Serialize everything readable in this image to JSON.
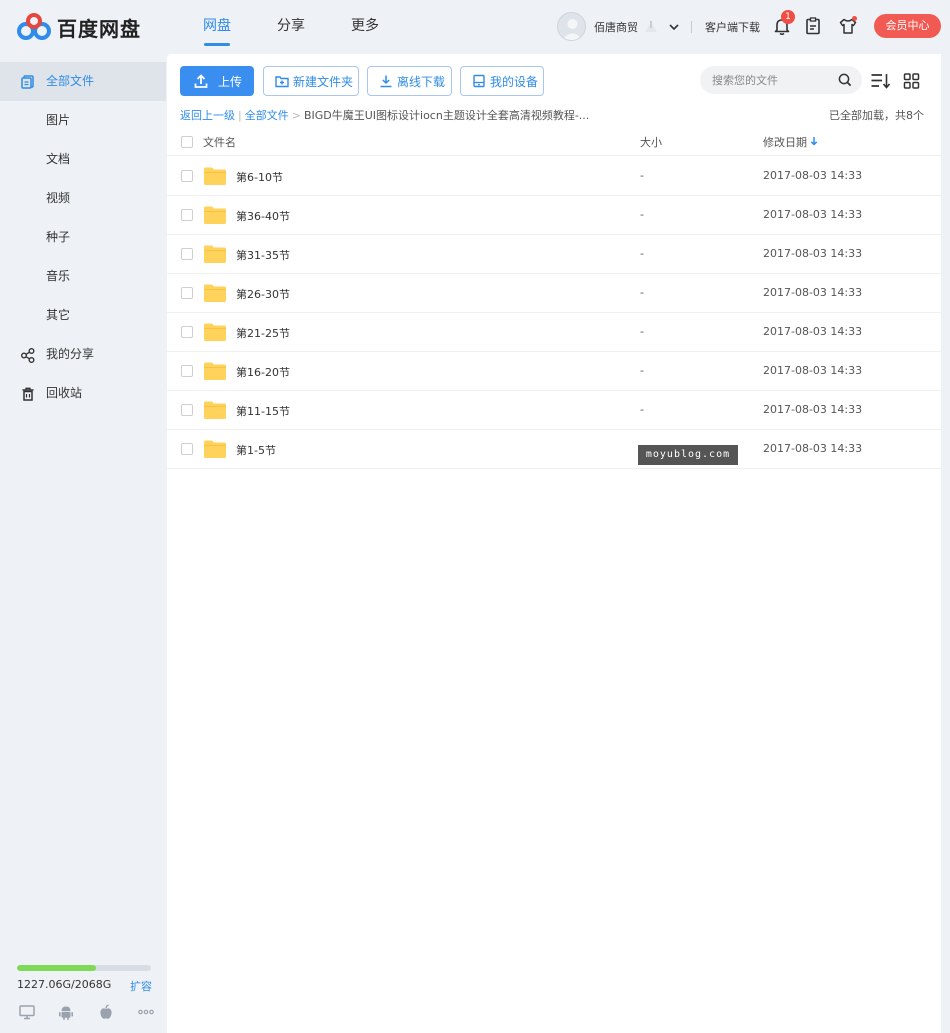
{
  "app": {
    "name": "百度网盘"
  },
  "nav": {
    "tabs": [
      {
        "label": "网盘",
        "active": true
      },
      {
        "label": "分享",
        "active": false
      },
      {
        "label": "更多",
        "active": false
      }
    ]
  },
  "user": {
    "name": "佰唐商贸"
  },
  "header": {
    "client_download": "客户端下载",
    "notification_count": "1",
    "vip_label": "会员中心"
  },
  "colors": {
    "accent": "#2f8ce8",
    "vip": "#f15a52",
    "folder": "#ffd25c",
    "storage": "#7ed957"
  },
  "sidebar": {
    "items": [
      {
        "label": "全部文件",
        "icon": "all-files-icon",
        "active": true
      },
      {
        "label": "图片",
        "icon": "",
        "active": false
      },
      {
        "label": "文档",
        "icon": "",
        "active": false
      },
      {
        "label": "视频",
        "icon": "",
        "active": false
      },
      {
        "label": "种子",
        "icon": "",
        "active": false
      },
      {
        "label": "音乐",
        "icon": "",
        "active": false
      },
      {
        "label": "其它",
        "icon": "",
        "active": false
      },
      {
        "label": "我的分享",
        "icon": "share-icon",
        "active": false
      },
      {
        "label": "回收站",
        "icon": "trash-icon",
        "active": false
      }
    ],
    "storage": {
      "text": "1227.06G/2068G",
      "used_fraction": 0.593,
      "expand_label": "扩容"
    },
    "platforms": [
      "desktop-icon",
      "android-icon",
      "apple-icon",
      "more-icon"
    ]
  },
  "toolbar": {
    "upload_label": "上传",
    "new_folder_label": "新建文件夹",
    "offline_download_label": "离线下载",
    "my_devices_label": "我的设备"
  },
  "search": {
    "placeholder": "搜索您的文件"
  },
  "breadcrumb": {
    "back": "返回上一级",
    "root": "全部文件",
    "current": "BIGD牛魔王UI图标设计iocn主题设计全套高清视频教程-..."
  },
  "load_status": "已全部加载，共8个",
  "table": {
    "headers": {
      "name": "文件名",
      "size": "大小",
      "date": "修改日期"
    },
    "rows": [
      {
        "name": "第6-10节",
        "size": "-",
        "date": "2017-08-03 14:33"
      },
      {
        "name": "第36-40节",
        "size": "-",
        "date": "2017-08-03 14:33"
      },
      {
        "name": "第31-35节",
        "size": "-",
        "date": "2017-08-03 14:33"
      },
      {
        "name": "第26-30节",
        "size": "-",
        "date": "2017-08-03 14:33"
      },
      {
        "name": "第21-25节",
        "size": "-",
        "date": "2017-08-03 14:33"
      },
      {
        "name": "第16-20节",
        "size": "-",
        "date": "2017-08-03 14:33"
      },
      {
        "name": "第11-15节",
        "size": "-",
        "date": "2017-08-03 14:33"
      },
      {
        "name": "第1-5节",
        "size": "",
        "date": "2017-08-03 14:33"
      }
    ]
  },
  "watermark": "moyublog.com"
}
